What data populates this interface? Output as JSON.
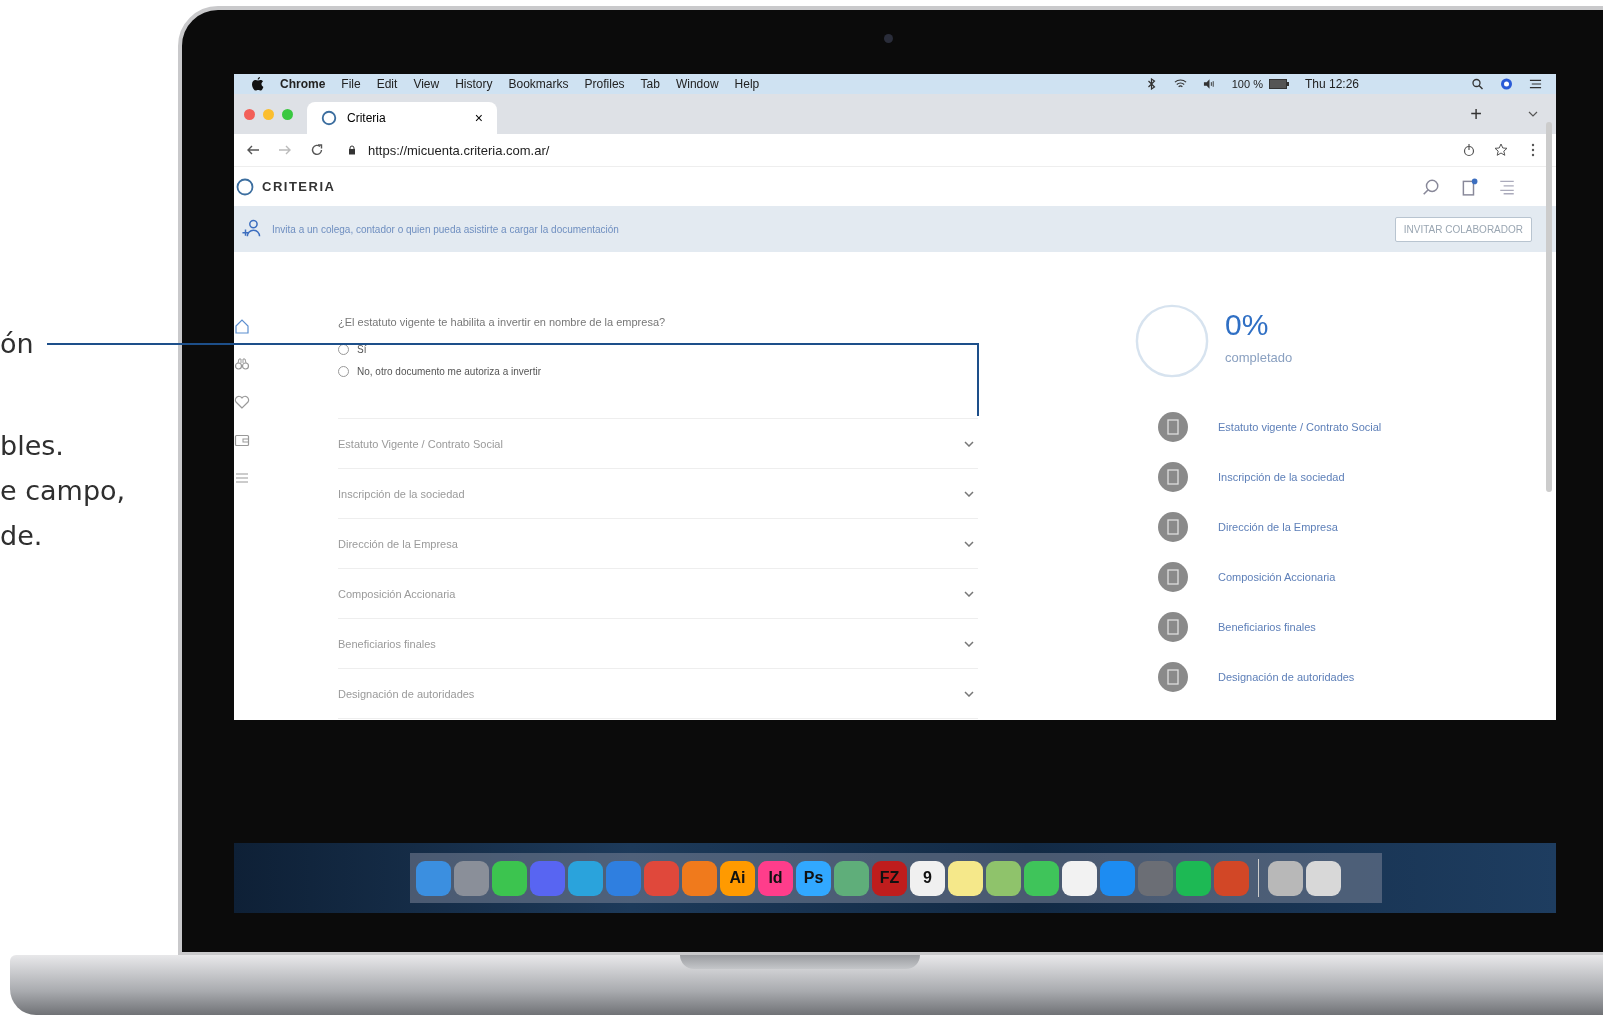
{
  "annotation": {
    "heading": "ón",
    "body": [
      "bles.",
      "e campo,",
      "de."
    ]
  },
  "menubar": {
    "app_name": "Chrome",
    "menus": [
      "File",
      "Edit",
      "View",
      "History",
      "Bookmarks",
      "Profiles",
      "Tab",
      "Window",
      "Help"
    ],
    "battery": "100 %",
    "clock": "Thu 12:26"
  },
  "browser": {
    "tab_title": "Criteria",
    "tab_close": "×",
    "new_tab": "+",
    "url": "https://micuenta.criteria.com.ar/"
  },
  "page": {
    "logo": "CRITERIA",
    "banner_text": "Invita a un colega, contador o quien pueda asistirte a cargar la documentación",
    "banner_button": "INVITAR COLABORADOR"
  },
  "question": {
    "text": "¿El estatuto vigente te habilita a invertir en nombre de la empresa?",
    "options": [
      {
        "label": "Sí",
        "selected": false
      },
      {
        "label": "No, otro documento me autoriza a invertir",
        "selected": false
      }
    ]
  },
  "sections": [
    {
      "label": "Estatuto Vigente / Contrato Social",
      "expanded": false
    },
    {
      "label": "Inscripción de la sociedad",
      "expanded": false
    },
    {
      "label": "Dirección de la Empresa",
      "expanded": false
    },
    {
      "label": "Composición Accionaria",
      "expanded": false
    },
    {
      "label": "Beneficiarios finales",
      "expanded": false
    },
    {
      "label": "Designación de autoridades",
      "expanded": false
    }
  ],
  "progress": {
    "percent": "0%",
    "caption": "completado"
  },
  "steps": [
    "Estatuto vigente / Contrato Social",
    "Inscripción de la sociedad",
    "Dirección de la Empresa",
    "Composición Accionaria",
    "Beneficiarios finales",
    "Designación de autoridades"
  ],
  "dock": [
    {
      "kind": "plain",
      "color": "#3b8fe0"
    },
    {
      "kind": "plain",
      "color": "#8a8f99"
    },
    {
      "kind": "plain",
      "color": "#3cc44f"
    },
    {
      "kind": "plain",
      "color": "#5865f2"
    },
    {
      "kind": "plain",
      "color": "#2aa3dc"
    },
    {
      "kind": "plain",
      "color": "#2f7fe0"
    },
    {
      "kind": "plain",
      "color": "#e0483b"
    },
    {
      "kind": "plain",
      "color": "#f07a1c"
    },
    {
      "kind": "text",
      "label": "Ai",
      "color": "#ff9a00"
    },
    {
      "kind": "text",
      "label": "Id",
      "color": "#ff3d8b"
    },
    {
      "kind": "text",
      "label": "Ps",
      "color": "#31a8ff"
    },
    {
      "kind": "plain",
      "color": "#5fae7a"
    },
    {
      "kind": "text",
      "label": "FZ",
      "color": "#bf1d1d"
    },
    {
      "kind": "text",
      "label": "9",
      "color": "#f0f0f0"
    },
    {
      "kind": "plain",
      "color": "#f5e88a"
    },
    {
      "kind": "plain",
      "color": "#8fc36b"
    },
    {
      "kind": "plain",
      "color": "#3fc45a"
    },
    {
      "kind": "plain",
      "color": "#f2f2f2"
    },
    {
      "kind": "plain",
      "color": "#1d8cf2"
    },
    {
      "kind": "plain",
      "color": "#6b6e75"
    },
    {
      "kind": "plain",
      "color": "#1db954"
    },
    {
      "kind": "plain",
      "color": "#d24726"
    },
    {
      "kind": "plain",
      "color": "#b8b8b8"
    },
    {
      "kind": "plain",
      "color": "#d8d8d8"
    }
  ]
}
